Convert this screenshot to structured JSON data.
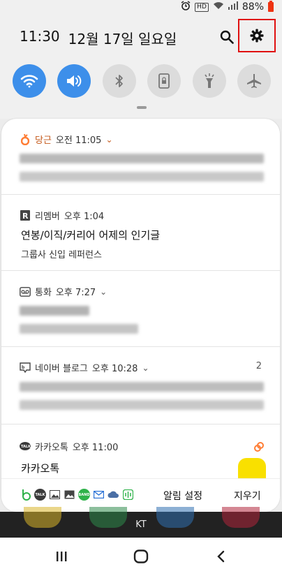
{
  "status": {
    "battery": "88%",
    "hd": "HD"
  },
  "header": {
    "time": "11:30",
    "date": "12월 17일 일요일"
  },
  "quick_settings": [
    {
      "name": "wifi",
      "on": true
    },
    {
      "name": "sound",
      "on": true
    },
    {
      "name": "bluetooth",
      "on": false
    },
    {
      "name": "rotation-lock",
      "on": false
    },
    {
      "name": "flashlight",
      "on": false
    },
    {
      "name": "airplane-mode",
      "on": false
    }
  ],
  "notifications": {
    "daangn": {
      "app": "당근",
      "time": "오전 11:05"
    },
    "remember": {
      "app": "리멤버",
      "time": "오후 1:04",
      "title": "연봉/이직/커리어 어제의 인기글",
      "body": "그룹사 신입 레퍼런스"
    },
    "call": {
      "app": "통화",
      "time": "오후 7:27"
    },
    "naver_blog": {
      "app": "네이버 블로그",
      "time": "오후 10:28",
      "count": "2"
    },
    "kakaotalk": {
      "app": "카카오톡",
      "time": "오후 11:00",
      "title": "카카오톡"
    }
  },
  "footer": {
    "settings_label": "알림 설정",
    "clear_label": "지우기"
  },
  "carrier": "KT",
  "colors": {
    "accent": "#3d8fea",
    "highlight": "#e01010",
    "daangn": "#ff7e36",
    "kakao": "#f9e000"
  }
}
